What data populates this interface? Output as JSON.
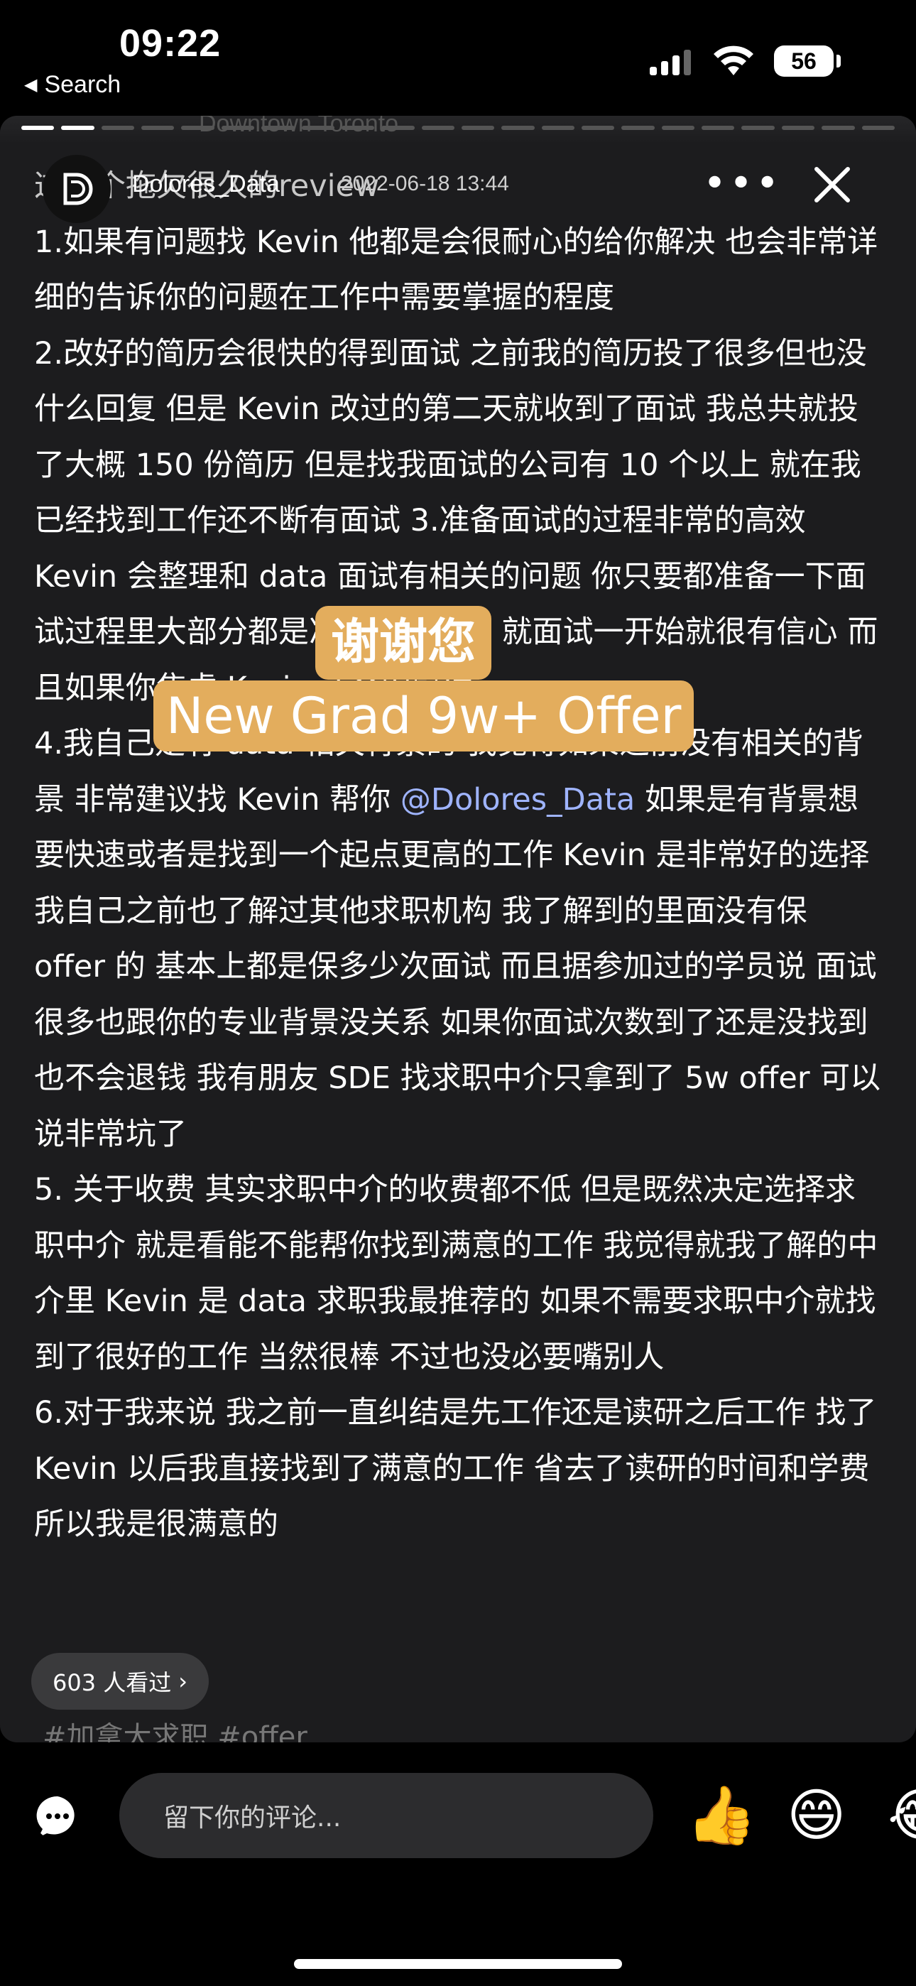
{
  "status_bar": {
    "time": "09:22",
    "back_label": "Search",
    "battery": "56"
  },
  "story": {
    "background_location": "Downtown Toronto",
    "author": "Dolores_Data",
    "date": "2022-06-18 13:44",
    "paragraphs": [
      "这一个拖欠很久的review",
      "1.如果有问题找 Kevin 他都是会很耐心的给你解决 也会非常详细的告诉你的问题在工作中需要掌握的程度",
      "2.改好的简历会很快的得到面试 之前我的简历投了很多但也没什么回复 但是 Kevin 改过的第二天就收到了面试 我总共就投了大概 150 份简历 但是找我面试的公司有 10 个以上 就在我已经找到工作还不断有面试 3.准备面试的过程非常的高效 Kevin 会整理和 data 面试有相关的问题 你只要都准备一下面试过程里大部分都是准备过的问题 就面试一开始就很有信心 而且如果你焦虑 Kevin 还会安慰你",
      "4.我自己是有 data 相关背景的 我觉得如果之前没有相关的背景 非常建议找 Kevin 帮你 ",
      "如果是有背景想要快速或者是找到一个起点更高的工作 Kevin 是非常好的选择 我自己之前也了解过其他求职机构 我了解到的里面没有保 offer 的 基本上都是保多少次面试 而且据参加过的学员说 面试很多也跟你的专业背景没关系 如果你面试次数到了还是没找到也不会退钱 我有朋友 SDE 找求职中介只拿到了 5w offer 可以说非常坑了",
      "5. 关于收费 其实求职中介的收费都不低 但是既然决定选择求职中介 就是看能不能帮你找到满意的工作 我觉得就我了解的中介里 Kevin 是 data 求职我最推荐的 如果不需要求职中介就找到了很好的工作 当然很棒 不过也没必要嘴别人",
      "6.对于我来说 我之前一直纠结是先工作还是读研之后工作 找了 Kevin 以后我直接找到了满意的工作 省去了读研的时间和学费 所以我是很满意的"
    ],
    "mention": "@Dolores_Data",
    "sticker_1": "谢谢您",
    "sticker_2": "New Grad 9w+ Offer",
    "views": "603 人看过",
    "hashtags": "#加拿大求职 #offer"
  },
  "bottom_bar": {
    "comment_placeholder": "留下你的评论...",
    "reactions": [
      "thumbs-up",
      "grinning",
      "laughing-tears"
    ]
  }
}
